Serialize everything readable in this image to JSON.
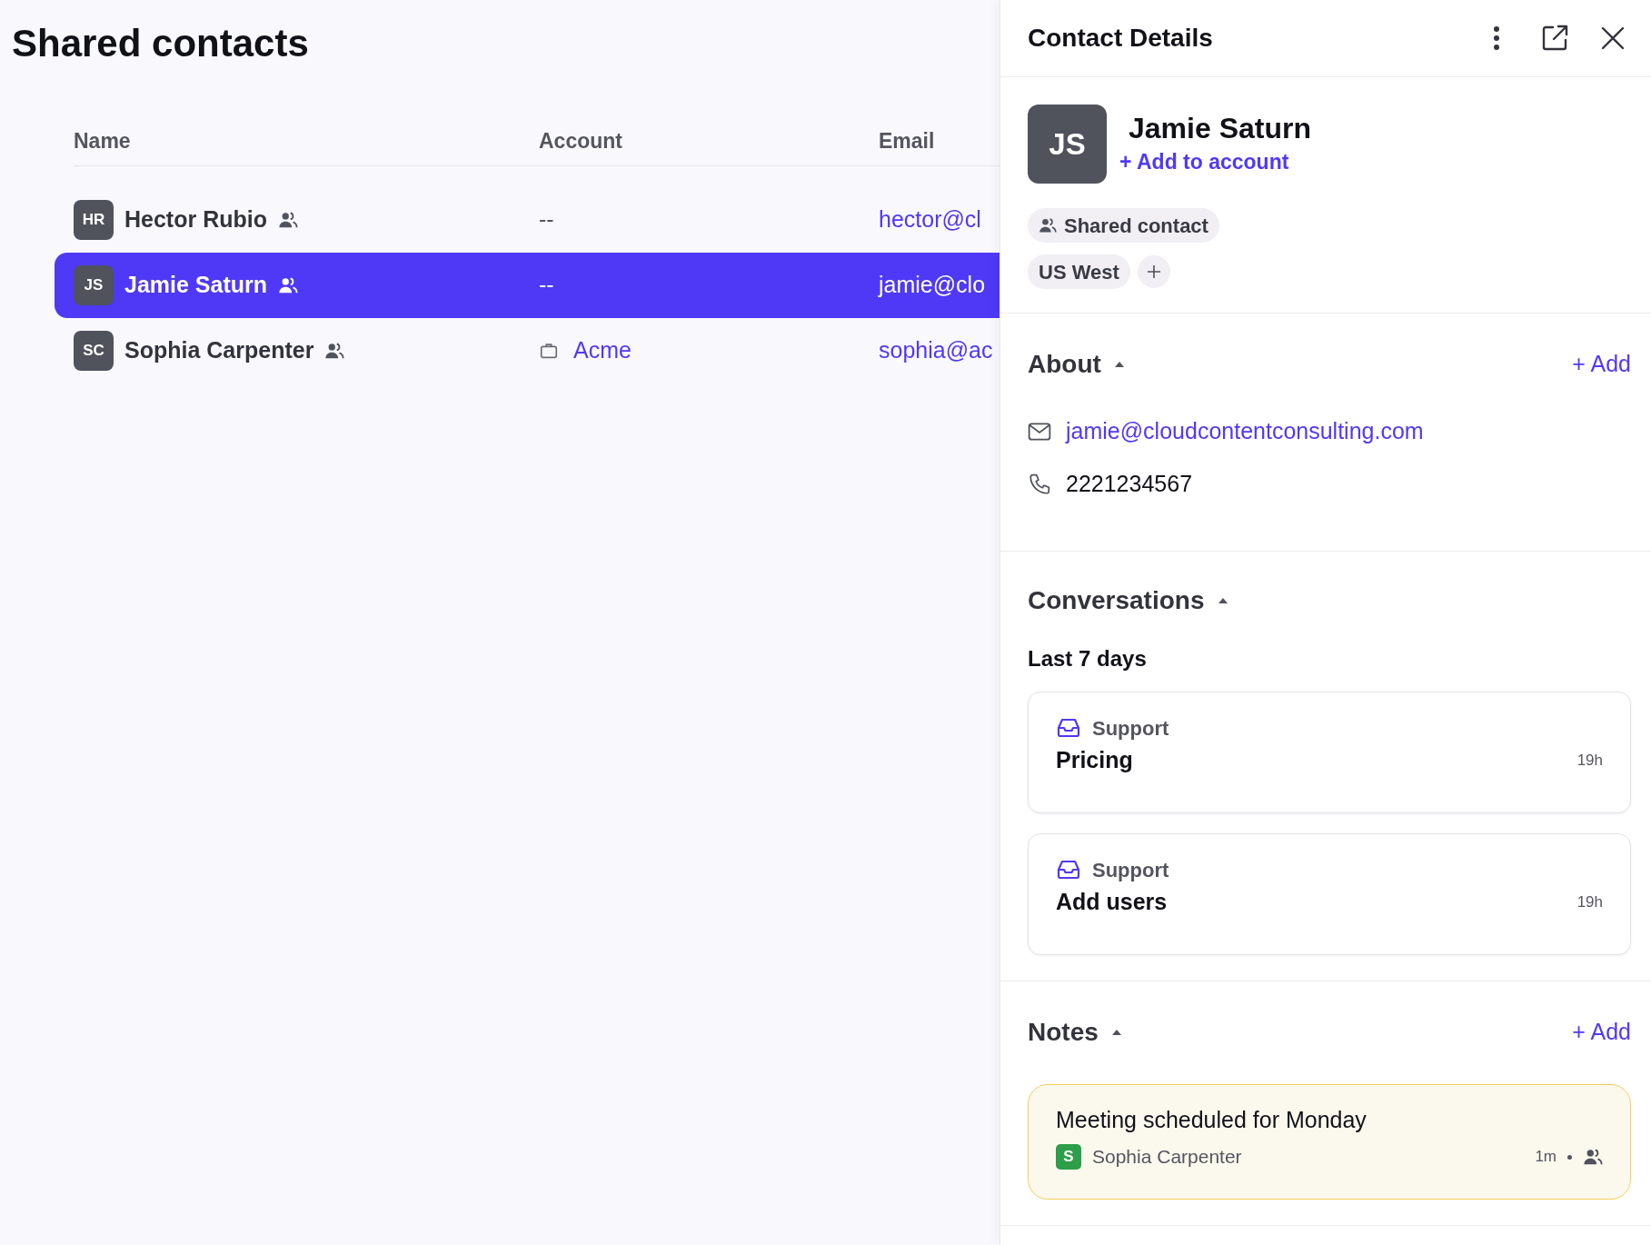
{
  "page": {
    "title": "Shared contacts"
  },
  "table": {
    "columns": [
      "Name",
      "Account",
      "Email"
    ],
    "rows": [
      {
        "initials": "HR",
        "name": "Hector Rubio",
        "shared": true,
        "account": {
          "kind": "empty",
          "text": "--"
        },
        "email": "hector@cl",
        "selected": false
      },
      {
        "initials": "JS",
        "name": "Jamie Saturn",
        "shared": true,
        "account": {
          "kind": "empty",
          "text": "--"
        },
        "email": "jamie@clo",
        "selected": true
      },
      {
        "initials": "SC",
        "name": "Sophia Carpenter",
        "shared": true,
        "account": {
          "kind": "link",
          "text": "Acme"
        },
        "email": "sophia@ac",
        "selected": false
      }
    ]
  },
  "details": {
    "title": "Contact Details",
    "contact": {
      "initials": "JS",
      "name": "Jamie Saturn",
      "add_account": "+ Add to account"
    },
    "tags": [
      {
        "kind": "shared",
        "label": "Shared contact"
      },
      {
        "kind": "plain",
        "label": "US West"
      }
    ],
    "about": {
      "title": "About",
      "expanded": true,
      "add": "+ Add",
      "items": [
        {
          "kind": "email",
          "text": "jamie@cloudcontentconsulting.com"
        },
        {
          "kind": "phone",
          "text": "2221234567"
        }
      ]
    },
    "conversations": {
      "title": "Conversations",
      "expanded": true,
      "group": "Last 7 days",
      "items": [
        {
          "inbox": "Support",
          "subject": "Pricing",
          "time": "19h"
        },
        {
          "inbox": "Support",
          "subject": "Add users",
          "time": "19h"
        }
      ]
    },
    "notes": {
      "title": "Notes",
      "expanded": true,
      "add": "+ Add",
      "items": [
        {
          "text": "Meeting scheduled for Monday",
          "author_initial": "S",
          "author": "Sophia Carpenter",
          "time": "1m",
          "shared": true
        }
      ]
    }
  }
}
